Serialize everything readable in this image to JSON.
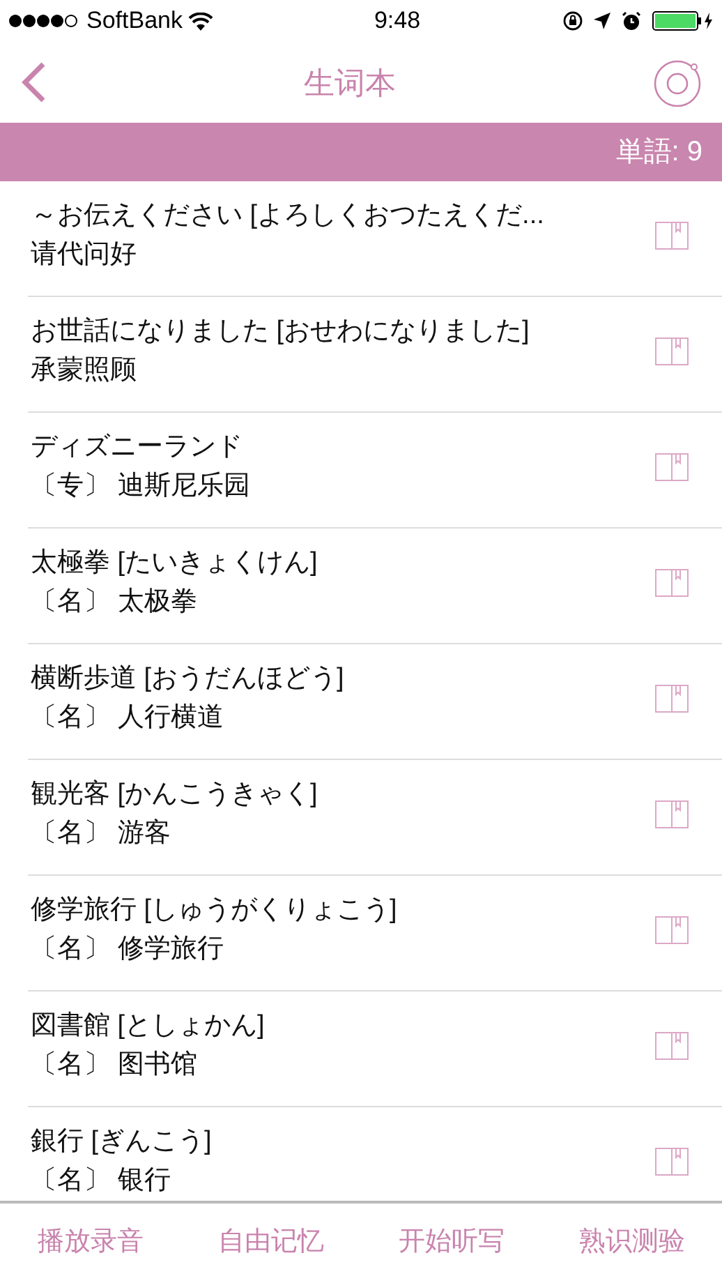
{
  "status_bar": {
    "carrier": "SoftBank",
    "time": "9:48"
  },
  "nav": {
    "title": "生词本"
  },
  "count_bar": {
    "label": "単語: 9"
  },
  "words": [
    {
      "word": "～お伝えください [よろしくおつたえくだ...",
      "meaning": "请代问好"
    },
    {
      "word": "お世話になりました [おせわになりました]",
      "meaning": "承蒙照顾"
    },
    {
      "word": "ディズニーランド",
      "meaning": "〔专〕 迪斯尼乐园"
    },
    {
      "word": "太極拳 [たいきょくけん]",
      "meaning": "〔名〕 太极拳"
    },
    {
      "word": "横断歩道 [おうだんほどう]",
      "meaning": "〔名〕 人行横道"
    },
    {
      "word": "観光客 [かんこうきゃく]",
      "meaning": "〔名〕 游客"
    },
    {
      "word": "修学旅行 [しゅうがくりょこう]",
      "meaning": "〔名〕 修学旅行"
    },
    {
      "word": "図書館 [としょかん]",
      "meaning": "〔名〕 图书馆"
    },
    {
      "word": "銀行 [ぎんこう]",
      "meaning": "〔名〕 银行"
    }
  ],
  "bottom_actions": [
    "播放录音",
    "自由记忆",
    "开始听写",
    "熟识测验"
  ]
}
